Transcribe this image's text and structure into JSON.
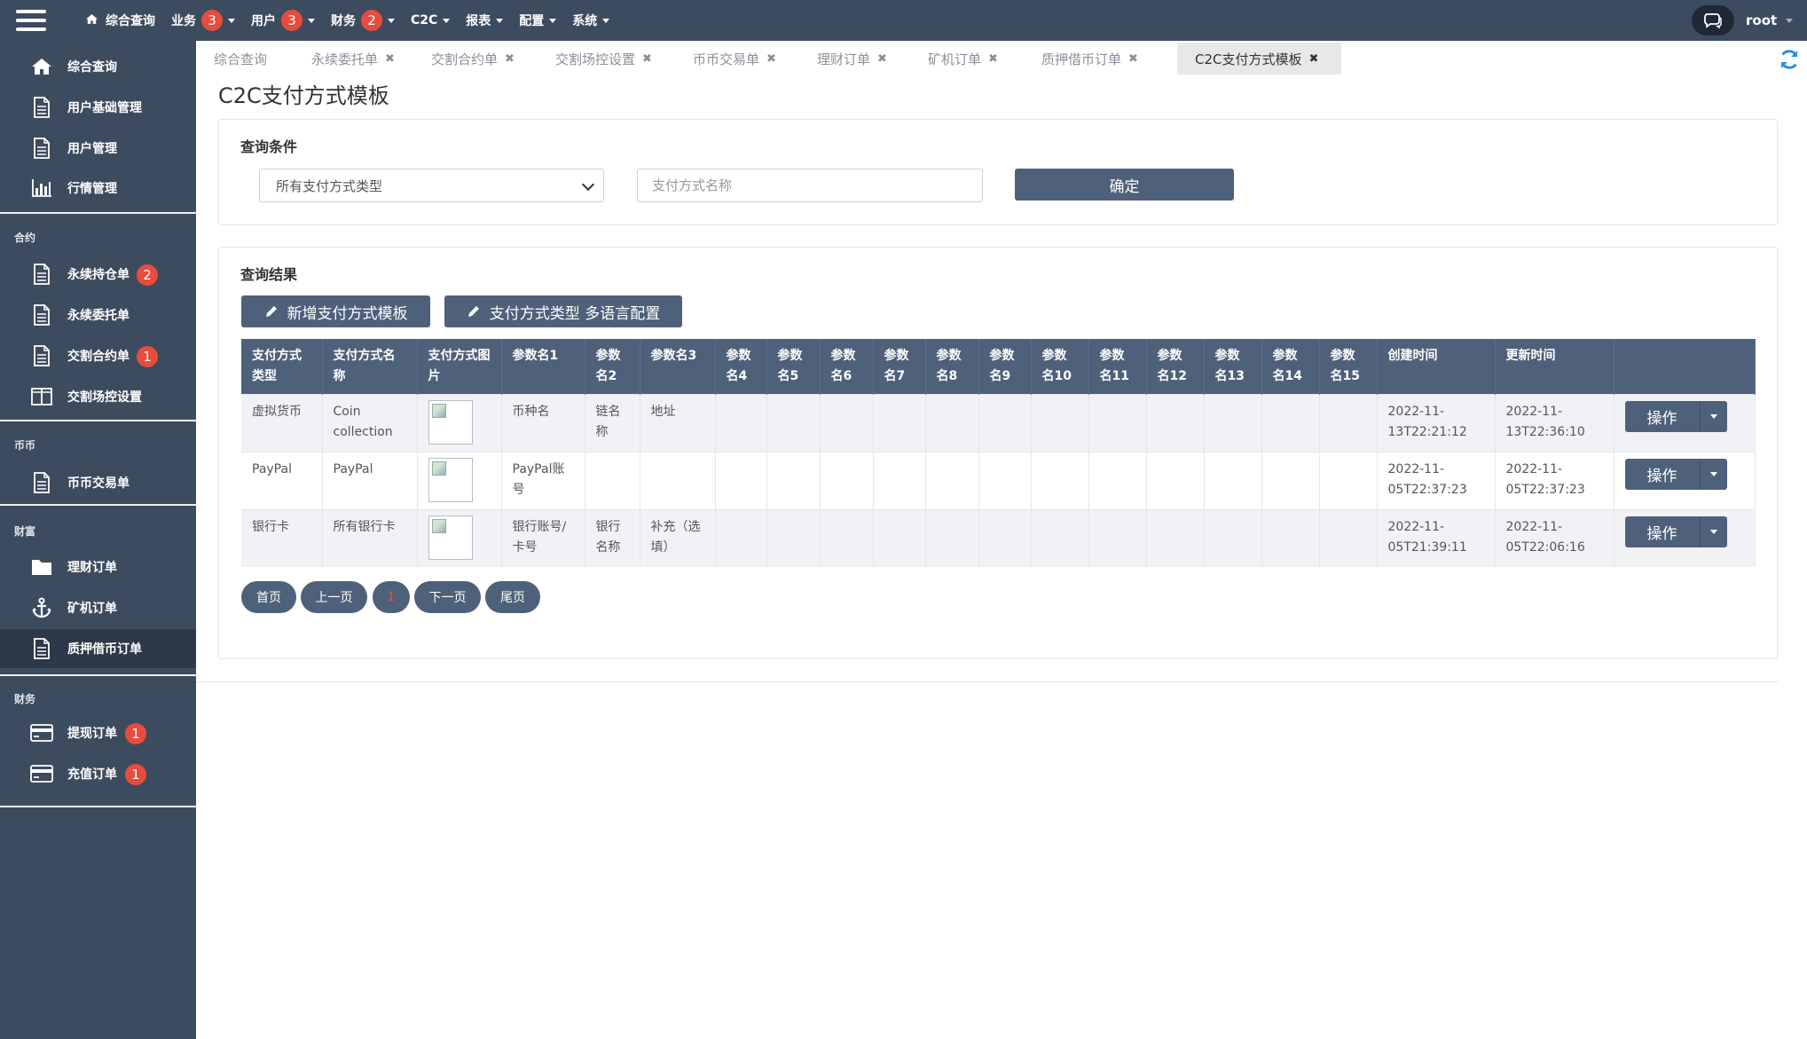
{
  "topbar": {
    "nav": [
      {
        "label": "综合查询",
        "badge": null,
        "dropdown": false,
        "icon": "home-icon"
      },
      {
        "label": "业务",
        "badge": "3",
        "dropdown": true
      },
      {
        "label": "用户",
        "badge": "3",
        "dropdown": true
      },
      {
        "label": "财务",
        "badge": "2",
        "dropdown": true
      },
      {
        "label": "C2C",
        "badge": null,
        "dropdown": true
      },
      {
        "label": "报表",
        "badge": null,
        "dropdown": true
      },
      {
        "label": "配置",
        "badge": null,
        "dropdown": true
      },
      {
        "label": "系统",
        "badge": null,
        "dropdown": true
      }
    ],
    "user": "root"
  },
  "sidebar": {
    "items": [
      {
        "label": "综合查询",
        "icon": "home-icon"
      },
      {
        "label": "用户基础管理",
        "icon": "document-icon"
      },
      {
        "label": "用户管理",
        "icon": "document-icon"
      },
      {
        "label": "行情管理",
        "icon": "bar-chart-icon"
      },
      {
        "label": "永续持仓单",
        "icon": "document-icon",
        "badge": "2"
      },
      {
        "label": "永续委托单",
        "icon": "document-icon"
      },
      {
        "label": "交割合约单",
        "icon": "document-icon",
        "badge": "1"
      },
      {
        "label": "交割场控设置",
        "icon": "columns-icon"
      },
      {
        "label": "币币交易单",
        "icon": "document-icon"
      },
      {
        "label": "理财订单",
        "icon": "folder-icon"
      },
      {
        "label": "矿机订单",
        "icon": "anchor-icon"
      },
      {
        "label": "质押借币订单",
        "icon": "document-icon",
        "active": true
      },
      {
        "label": "提现订单",
        "icon": "credit-card-icon",
        "badge": "1"
      },
      {
        "label": "充值订单",
        "icon": "credit-card-icon",
        "badge": "1"
      }
    ],
    "groups": [
      "合约",
      "币币",
      "财富",
      "财务"
    ]
  },
  "tabs": [
    {
      "label": "综合查询",
      "closable": false
    },
    {
      "label": "永续委托单",
      "closable": true
    },
    {
      "label": "交割合约单",
      "closable": true
    },
    {
      "label": "交割场控设置",
      "closable": true
    },
    {
      "label": "币币交易单",
      "closable": true
    },
    {
      "label": "理财订单",
      "closable": true
    },
    {
      "label": "矿机订单",
      "closable": true
    },
    {
      "label": "质押借币订单",
      "closable": true
    },
    {
      "label": "C2C支付方式模板",
      "closable": true,
      "active": true
    }
  ],
  "close_glyph": "✖",
  "page": {
    "title": "C2C支付方式模板"
  },
  "query": {
    "title": "查询条件",
    "type_select": "所有支付方式类型",
    "name_placeholder": "支付方式名称",
    "confirm_label": "确定"
  },
  "results": {
    "title": "查询结果",
    "add_label": "新增支付方式模板",
    "i18n_label": "支付方式类型 多语言配置",
    "columns": [
      "支付方式类型",
      "支付方式名称",
      "支付方式图片",
      "参数名1",
      "参数名2",
      "参数名3",
      "参数名4",
      "参数名5",
      "参数名6",
      "参数名7",
      "参数名8",
      "参数名9",
      "参数名10",
      "参数名11",
      "参数名12",
      "参数名13",
      "参数名14",
      "参数名15",
      "创建时间",
      "更新时间",
      ""
    ],
    "rows": [
      {
        "type": "虚拟货币",
        "name": "Coin collection",
        "p1": "币种名",
        "p2": "链名称",
        "p3": "地址",
        "created": "2022-11-13T22:21:12",
        "updated": "2022-11-13T22:36:10"
      },
      {
        "type": "PayPal",
        "name": "PayPal",
        "p1": "PayPal账号",
        "p2": "",
        "p3": "",
        "created": "2022-11-05T22:37:23",
        "updated": "2022-11-05T22:37:23"
      },
      {
        "type": "银行卡",
        "name": "所有银行卡",
        "p1": "银行账号/卡号",
        "p2": "银行名称",
        "p3": "补充（选填）",
        "created": "2022-11-05T21:39:11",
        "updated": "2022-11-05T22:06:16"
      }
    ],
    "op_label": "操作"
  },
  "pagination": {
    "first": "首页",
    "prev": "上一页",
    "current": "1",
    "next": "下一页",
    "last": "尾页"
  },
  "colors": {
    "topbar": "#3d4b5f",
    "button": "#4f617a",
    "badge": "#e74c3c",
    "refresh": "#2f8fd8"
  }
}
